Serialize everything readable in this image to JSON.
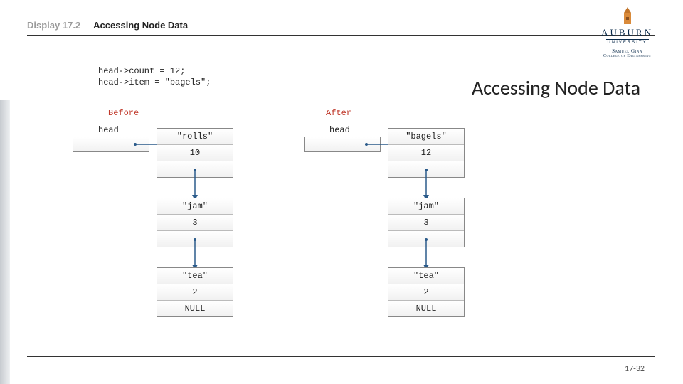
{
  "header": {
    "display_label": "Display 17.2",
    "title": "Accessing Node Data"
  },
  "logo": {
    "main": "AUBURN",
    "sub": "UNIVERSITY",
    "college1": "Samuel Ginn",
    "college2": "College of Engineering"
  },
  "slide_title": "Accessing Node Data",
  "code": {
    "line1": "head->count = 12;",
    "line2": "head->item = \"bagels\";"
  },
  "labels": {
    "before": "Before",
    "after": "After",
    "head": "head"
  },
  "before": {
    "node1": {
      "item": "\"rolls\"",
      "count": "10"
    },
    "node2": {
      "item": "\"jam\"",
      "count": "3"
    },
    "node3": {
      "item": "\"tea\"",
      "count": "2",
      "next": "NULL"
    }
  },
  "after": {
    "node1": {
      "item": "\"bagels\"",
      "count": "12"
    },
    "node2": {
      "item": "\"jam\"",
      "count": "3"
    },
    "node3": {
      "item": "\"tea\"",
      "count": "2",
      "next": "NULL"
    }
  },
  "page": "17-32"
}
